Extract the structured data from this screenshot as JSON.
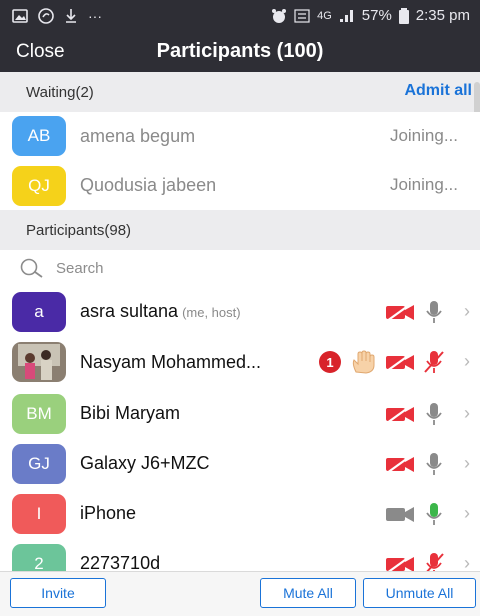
{
  "status": {
    "left_dots": "···",
    "battery": "57%",
    "time": "2:35 pm",
    "net": "4G"
  },
  "header": {
    "close": "Close",
    "title": "Participants (100)"
  },
  "waiting": {
    "label": "Waiting(2)",
    "admit_all": "Admit all",
    "items": [
      {
        "initials": "AB",
        "name": "amena begum",
        "status": "Joining...",
        "color": "#4aa3f0"
      },
      {
        "initials": "QJ",
        "name": "Quodusia jabeen",
        "status": "Joining...",
        "color": "#f5d21a"
      }
    ]
  },
  "participants": {
    "label": "Participants(98)",
    "search_placeholder": "Search",
    "items": [
      {
        "initials": "a",
        "name": "asra sultana",
        "tag": "(me, host)",
        "color": "#4a2aa6",
        "video": "off",
        "mic": "on-gray"
      },
      {
        "initials": "",
        "name": "Nasyam Mohammed...",
        "tag": "",
        "color": "photo",
        "badge": "1",
        "hand": true,
        "video": "off",
        "mic": "muted"
      },
      {
        "initials": "BM",
        "name": "Bibi Maryam",
        "tag": "",
        "color": "#9ad07d",
        "video": "off",
        "mic": "on-gray"
      },
      {
        "initials": "GJ",
        "name": "Galaxy J6+MZC",
        "tag": "",
        "color": "#6a7cc8",
        "video": "off",
        "mic": "on-gray"
      },
      {
        "initials": "I",
        "name": "iPhone",
        "tag": "",
        "color": "#f05a5a",
        "video": "on",
        "mic": "on-green"
      },
      {
        "initials": "2",
        "name": "2273710d",
        "tag": "",
        "color": "#6cc59a",
        "video": "off",
        "mic": "muted"
      }
    ]
  },
  "footer": {
    "invite": "Invite",
    "mute_all": "Mute All",
    "unmute_all": "Unmute All"
  },
  "colors": {
    "header": "#2e2e35",
    "accent": "#1a73d8",
    "muted_red": "#e8313b"
  }
}
